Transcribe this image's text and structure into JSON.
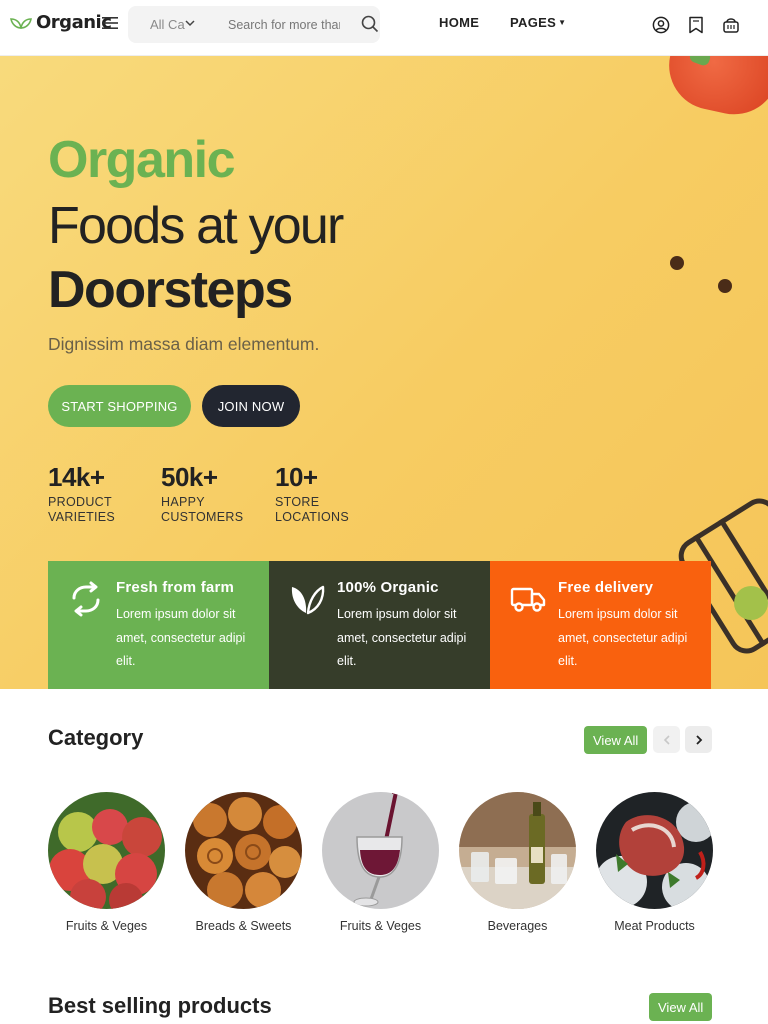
{
  "header": {
    "brand": "Organic",
    "search": {
      "category": "All Ca",
      "placeholder": "Search for more than"
    },
    "nav": {
      "home": "HOME",
      "pages": "PAGES"
    },
    "icons": [
      "menu-icon",
      "search-icon",
      "user-icon",
      "wishlist-icon",
      "cart-icon"
    ]
  },
  "hero": {
    "line1": "Organic",
    "line2": "Foods at your",
    "line3": "Doorsteps",
    "subtitle": "Dignissim massa diam elementum.",
    "buttons": {
      "shop": "START SHOPPING",
      "join": "JOIN NOW"
    },
    "stats": [
      {
        "number": "14k+",
        "label_line1": "PRODUCT",
        "label_line2": "VARIETIES"
      },
      {
        "number": "50k+",
        "label_line1": "HAPPY",
        "label_line2": "CUSTOMERS"
      },
      {
        "number": "10+",
        "label_line1": "STORE",
        "label_line2": "LOCATIONS"
      }
    ]
  },
  "features": [
    {
      "title": "Fresh from farm",
      "text": "Lorem ipsum dolor sit amet, consectetur adipi elit.",
      "icon": "refresh-icon",
      "color": "#6bb252"
    },
    {
      "title": "100% Organic",
      "text": "Lorem ipsum dolor sit amet, consectetur adipi elit.",
      "icon": "leaf-icon",
      "color": "#363d2a"
    },
    {
      "title": "Free delivery",
      "text": "Lorem ipsum dolor sit amet, consectetur adipi elit.",
      "icon": "truck-icon",
      "color": "#f9610e"
    }
  ],
  "category": {
    "title": "Category",
    "view_all": "View All",
    "items": [
      {
        "label": "Fruits & Veges"
      },
      {
        "label": "Breads & Sweets"
      },
      {
        "label": "Fruits & Veges"
      },
      {
        "label": "Beverages"
      },
      {
        "label": "Meat Products"
      }
    ]
  },
  "best_selling": {
    "title": "Best selling products",
    "view_all": "View All"
  },
  "colors": {
    "accent_green": "#6bb252",
    "dark": "#222630",
    "orange": "#f9610e",
    "olive": "#363d2a",
    "hero_bg": "#f7cc62"
  }
}
